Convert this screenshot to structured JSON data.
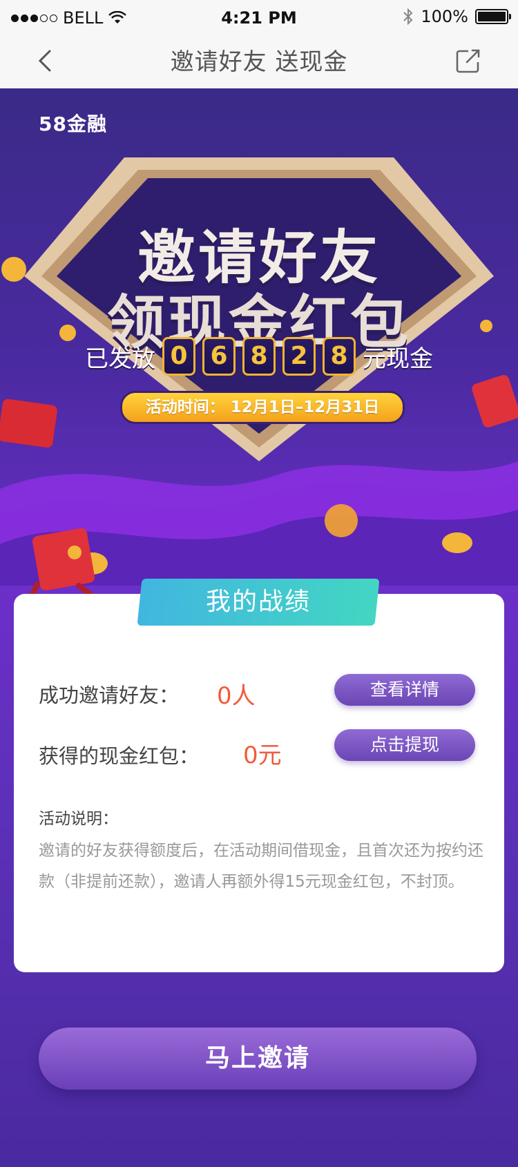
{
  "status_bar": {
    "carrier": "BELL",
    "time": "4:21 PM",
    "battery": "100%"
  },
  "nav": {
    "title": "邀请好友  送现金"
  },
  "hero": {
    "brand": "58金融",
    "headline_1": "邀请好友",
    "headline_2": "领现金红包",
    "counter_prefix": "已发放",
    "counter_digits": [
      "0",
      "6",
      "8",
      "2",
      "8"
    ],
    "counter_suffix": "元现金",
    "period": "活动时间：  12月1日–12月31日"
  },
  "card": {
    "title": "我的战绩",
    "stats": [
      {
        "label": "成功邀请好友：",
        "value": "0人",
        "button": "查看详情"
      },
      {
        "label": "获得的现金红包：",
        "value": "0元",
        "button": "点击提现"
      }
    ],
    "note_title": "活动说明：",
    "note_body": "邀请的好友获得额度后，在活动期间借现金，且首次还为按约还款（非提前还款），邀请人再额外得15元现金红包，不封顶。"
  },
  "cta": {
    "label": "马上邀请"
  },
  "colors": {
    "accent_orange": "#f25a3c",
    "purple": "#6b45b5",
    "gold": "#f6c33a"
  }
}
